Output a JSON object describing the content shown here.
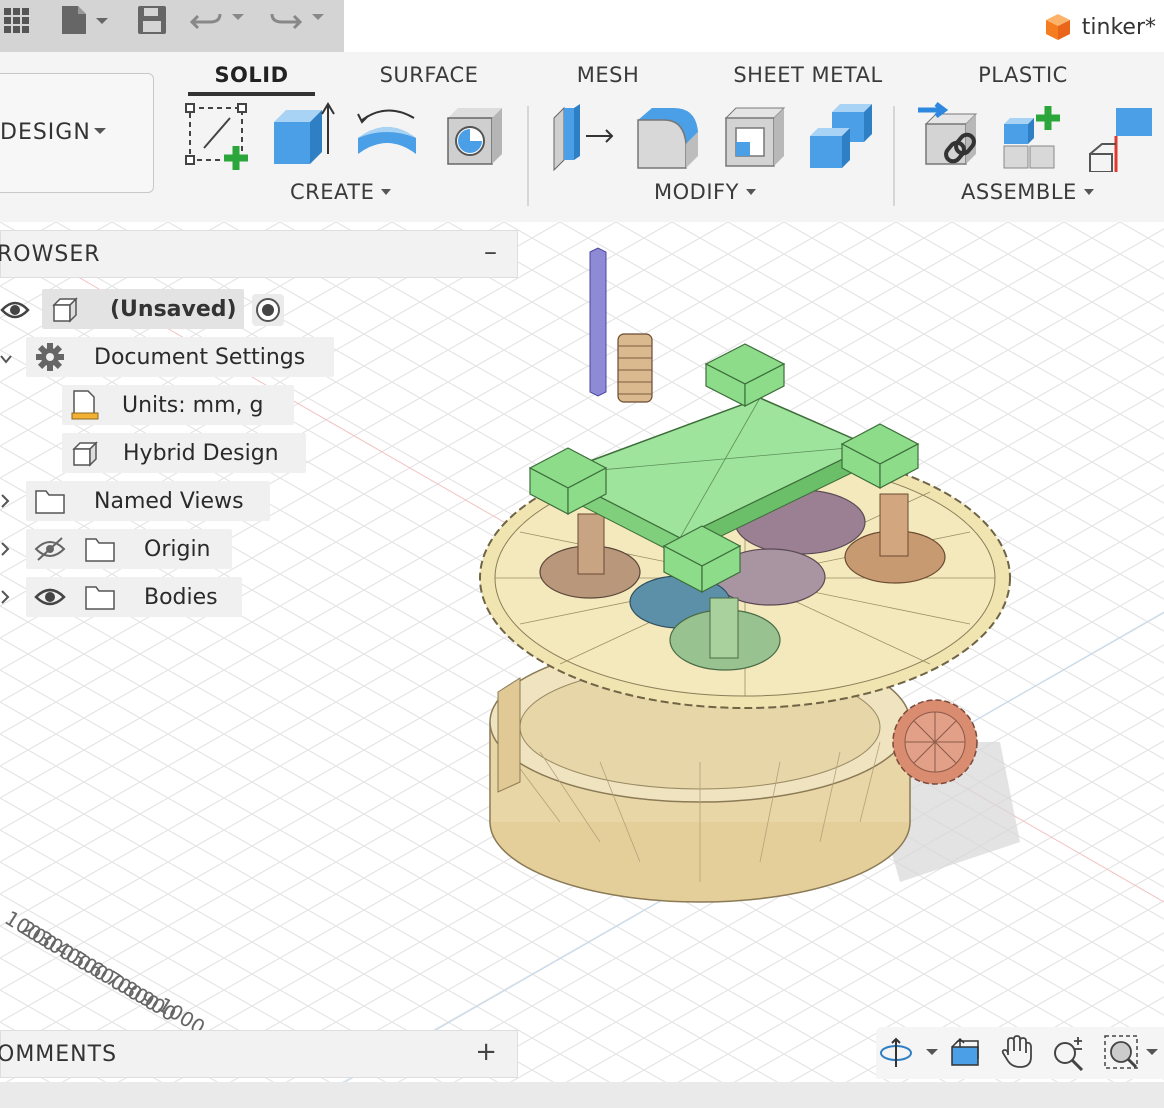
{
  "app": {
    "document_title": "tinker*"
  },
  "quick_access": {
    "icons": [
      "apps-grid-icon",
      "file-icon",
      "save-icon",
      "undo-icon",
      "redo-icon"
    ]
  },
  "workspace": {
    "label": "DESIGN"
  },
  "tabs": [
    {
      "label": "SOLID",
      "active": true
    },
    {
      "label": "SURFACE",
      "active": false
    },
    {
      "label": "MESH",
      "active": false
    },
    {
      "label": "SHEET METAL",
      "active": false
    },
    {
      "label": "PLASTIC",
      "active": false
    }
  ],
  "groups": {
    "create": {
      "label": "CREATE",
      "tools": [
        "create-sketch-icon",
        "extrude-icon",
        "revolve-icon",
        "hole-icon"
      ]
    },
    "modify": {
      "label": "MODIFY",
      "tools": [
        "press-pull-icon",
        "fillet-icon",
        "shell-icon",
        "combine-icon"
      ]
    },
    "assemble": {
      "label": "ASSEMBLE",
      "tools": [
        "joint-icon",
        "new-component-icon",
        "as-built-joint-icon"
      ]
    }
  },
  "browser": {
    "title": "ROWSER",
    "collapse_symbol": "–",
    "root": {
      "label": "(Unsaved)"
    },
    "items": [
      {
        "label": "Document Settings",
        "icon": "gear-icon"
      },
      {
        "label": "Units: mm, g",
        "icon": "units-icon"
      },
      {
        "label": "Hybrid Design",
        "icon": "component-icon"
      },
      {
        "label": "Named Views",
        "icon": "folder-icon"
      },
      {
        "label": "Origin",
        "icon": "folder-icon",
        "visible": false
      },
      {
        "label": "Bodies",
        "icon": "folder-icon",
        "visible": true
      }
    ]
  },
  "comments": {
    "title": "OMMENTS",
    "add_symbol": "+"
  },
  "ruler": {
    "labels": [
      "100",
      "200",
      "300",
      "400",
      "500",
      "600",
      "700",
      "800",
      "900",
      "1000"
    ]
  },
  "navigation": {
    "icons": [
      "orbit-icon",
      "look-at-icon",
      "pan-icon",
      "zoom-icon",
      "fit-icon"
    ]
  },
  "colors": {
    "ribbon_bg": "#f4f4f4",
    "qat_bg": "#d4d4d4",
    "accent_blue": "#3d8fd8",
    "accent_green": "#29a83a",
    "model_green": "#9be39a",
    "model_tan": "#e8d7a8"
  }
}
